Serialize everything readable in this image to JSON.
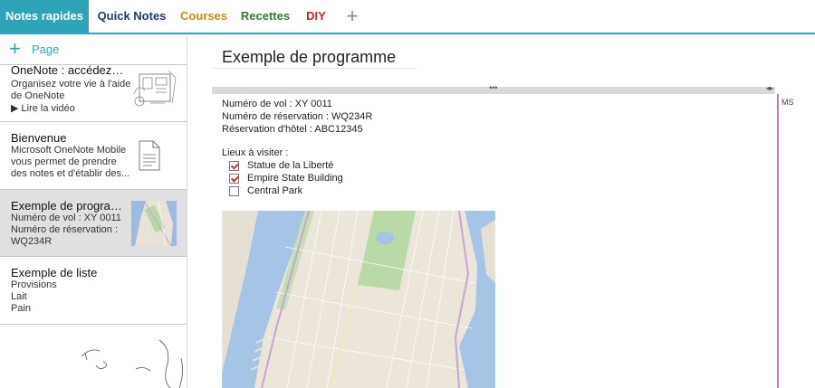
{
  "tabs": [
    {
      "label": "Notes rapides",
      "color": "#ffffff",
      "active": true
    },
    {
      "label": "Quick Notes",
      "color": "#1f3a6e",
      "active": false
    },
    {
      "label": "Courses",
      "color": "#d08a1a",
      "active": false
    },
    {
      "label": "Recettes",
      "color": "#2e7d32",
      "active": false
    },
    {
      "label": "DIY",
      "color": "#c62828",
      "active": false
    }
  ],
  "tab_add_icon": "plus-icon",
  "accent": "#2fa4b8",
  "sidebar": {
    "add_page_label": "Page",
    "pages": [
      {
        "title": "OneNote : accédez à...",
        "lines": [
          "Organisez votre vie à l'aide",
          "de OneNote",
          "▶ Lire la vidéo"
        ],
        "thumb": "notebook-sketch-thumbnail"
      },
      {
        "title": "Bienvenue",
        "lines": [
          "Microsoft OneNote Mobile",
          "vous permet de prendre",
          "des notes et d'établir des..."
        ],
        "thumb": "document-icon"
      },
      {
        "title": "Exemple de program...",
        "lines": [
          "Numéro de vol : XY 0011",
          "Numéro de réservation :",
          "WQ234R"
        ],
        "thumb": "map-thumbnail",
        "selected": true
      },
      {
        "title": "Exemple de liste",
        "lines": [
          "Provisions",
          "Lait",
          "Pain"
        ]
      }
    ]
  },
  "page": {
    "title": "Exemple de programme",
    "lines": [
      "Numéro de vol : XY 0011",
      "Numéro de réservation : WQ234R",
      "Réservation d'hôtel : ABC12345"
    ],
    "visit_label": "Lieux à visiter :",
    "checklist": [
      {
        "text": "Statue de la Liberté",
        "checked": true
      },
      {
        "text": "Empire State Building",
        "checked": true
      },
      {
        "text": "Central Park",
        "checked": false
      }
    ],
    "side_label": "MS",
    "side_line_color": "#c879c6"
  }
}
